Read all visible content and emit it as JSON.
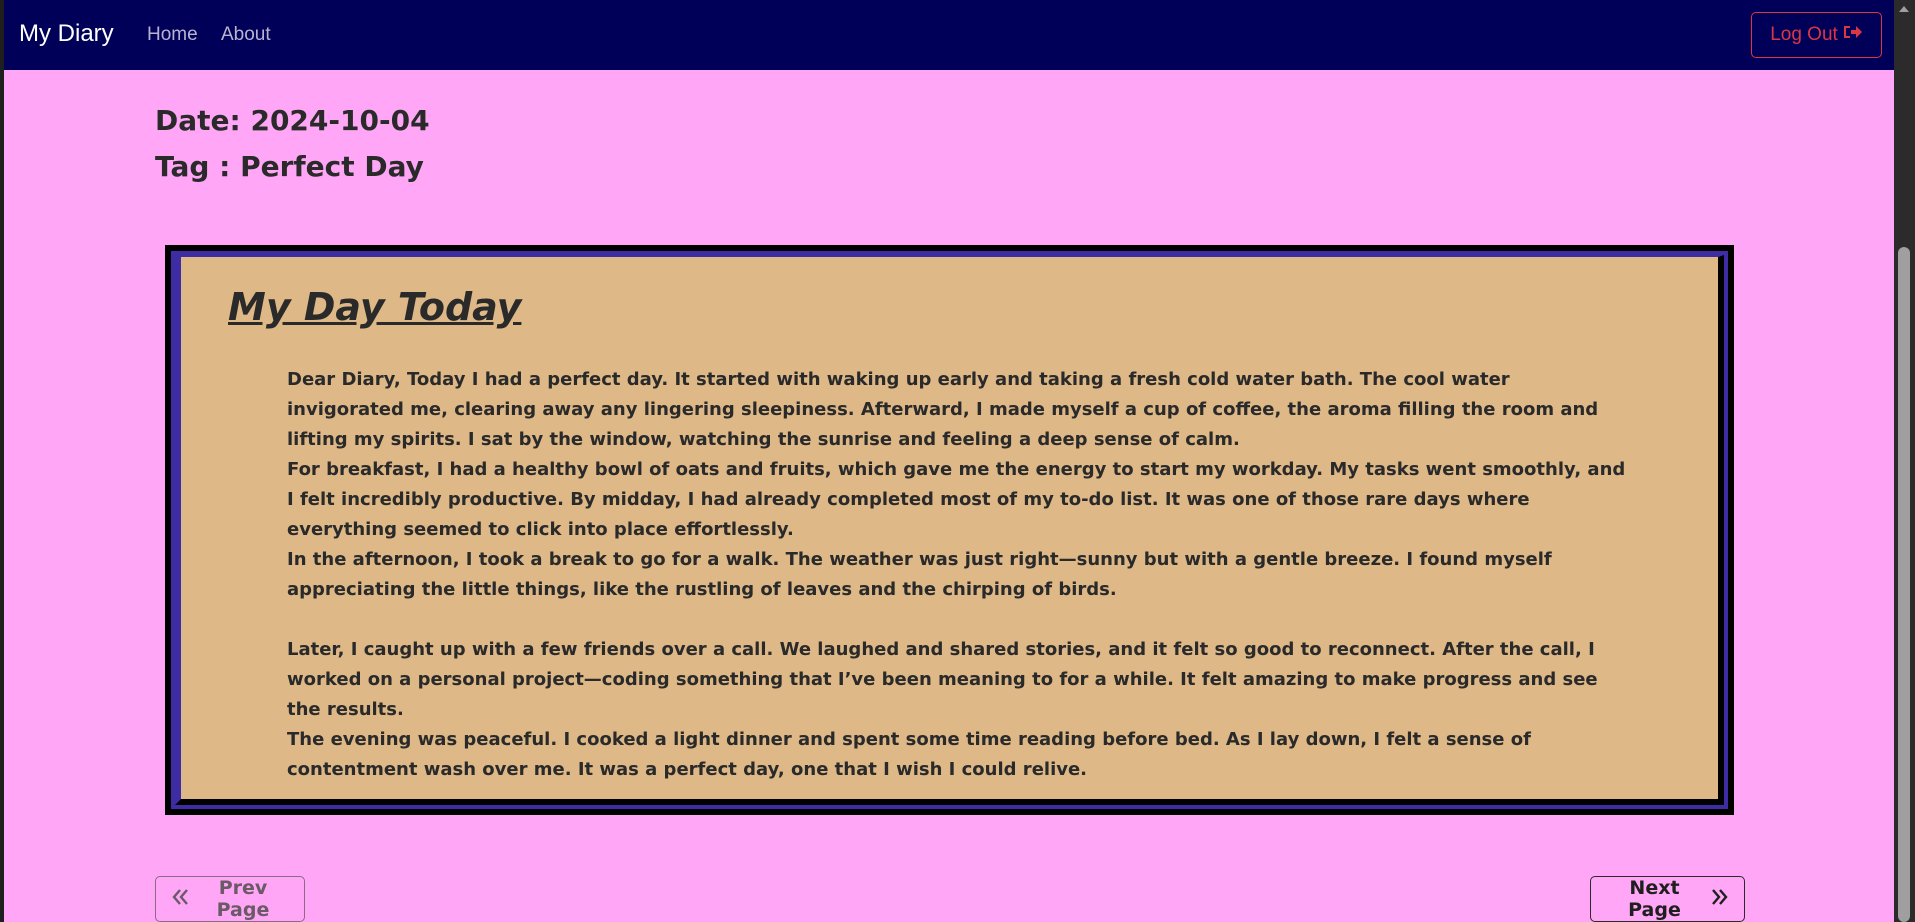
{
  "navbar": {
    "brand": "My Diary",
    "links": [
      {
        "label": "Home"
      },
      {
        "label": "About"
      }
    ],
    "logout_label": "Log Out",
    "logout_icon": "sign-out-icon",
    "background": "#000058",
    "logout_color": "#dc3545"
  },
  "entry": {
    "date_line": "Date: 2024-10-04",
    "tag_line": "Tag : Perfect Day",
    "title": "My Day Today",
    "paragraphs": [
      "Dear Diary, Today I had a perfect day. It started with waking up early and taking a fresh cold water bath. The cool water invigorated me, clearing away any lingering sleepiness. Afterward, I made myself a cup of coffee, the aroma filling the room and lifting my spirits. I sat by the window, watching the sunrise and feeling a deep sense of calm.",
      "For breakfast, I had a healthy bowl of oats and fruits, which gave me the energy to start my workday. My tasks went smoothly, and I felt incredibly productive. By midday, I had already completed most of my to-do list. It was one of those rare days where everything seemed to click into place effortlessly.",
      "In the afternoon, I took a break to go for a walk. The weather was just right—sunny but with a gentle breeze. I found myself appreciating the little things, like the rustling of leaves and the chirping of birds.",
      "Later, I caught up with a few friends over a call. We laughed and shared stories, and it felt so good to reconnect. After the call, I worked on a personal project—coding something that I’ve been meaning to for a while. It felt amazing to make progress and see the results.",
      "The evening was peaceful. I cooked a light dinner and spent some time reading before bed. As I lay down, I felt a sense of contentment wash over me. It was a perfect day, one that I wish I could relive."
    ],
    "paper_color": "#deb887",
    "border_color": "#3d2ca3"
  },
  "pager": {
    "prev_label": "Prev Page",
    "prev_icon": "double-chevron-left-icon",
    "next_label": "Next Page",
    "next_icon": "double-chevron-right-icon"
  },
  "page": {
    "background": "#ffa6f6"
  }
}
